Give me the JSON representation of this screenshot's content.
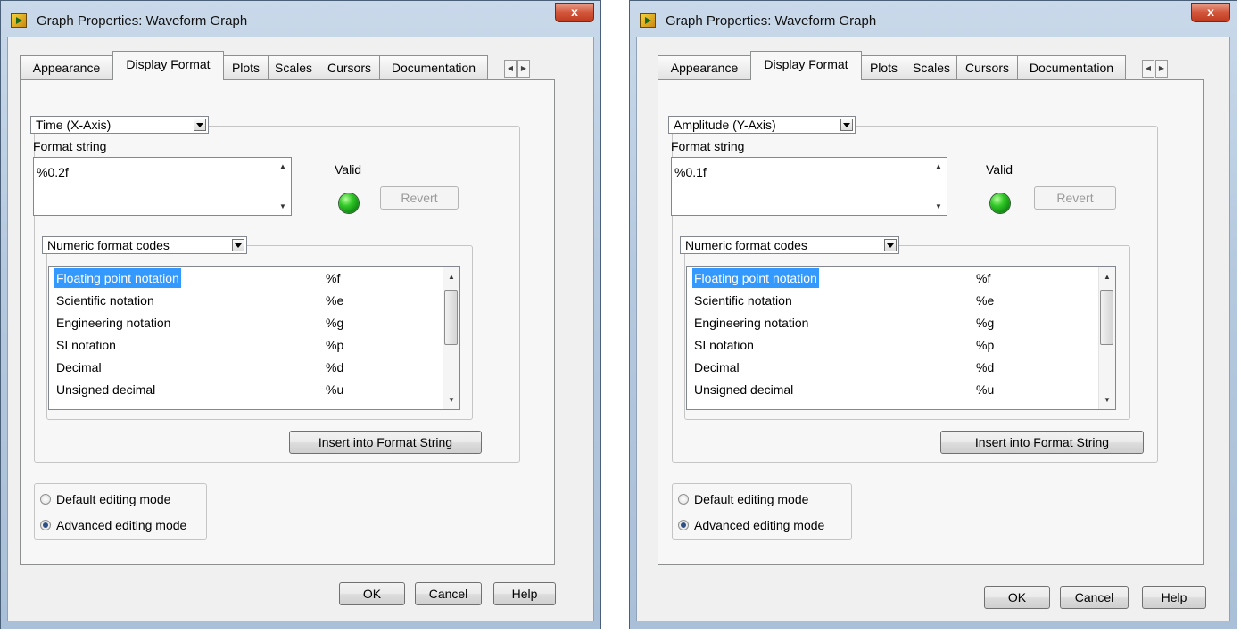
{
  "dialogs": [
    {
      "title": "Graph Properties: Waveform Graph",
      "close_label": "x",
      "tabs": [
        "Appearance",
        "Display Format",
        "Plots",
        "Scales",
        "Cursors",
        "Documentation"
      ],
      "active_tab": "Display Format",
      "axis_select": "Time (X-Axis)",
      "format_string_label": "Format string",
      "format_string_value": "%0.2f",
      "valid_label": "Valid",
      "revert_label": "Revert",
      "codes_select": "Numeric format codes",
      "codes": [
        {
          "name": "Floating point notation",
          "code": "%f"
        },
        {
          "name": "Scientific notation",
          "code": "%e"
        },
        {
          "name": "Engineering notation",
          "code": "%g"
        },
        {
          "name": "SI notation",
          "code": "%p"
        },
        {
          "name": "Decimal",
          "code": "%d"
        },
        {
          "name": "Unsigned decimal",
          "code": "%u"
        }
      ],
      "insert_label": "Insert into Format String",
      "modes": [
        "Default editing mode",
        "Advanced editing mode"
      ],
      "selected_mode": "Advanced editing mode",
      "ok_label": "OK",
      "cancel_label": "Cancel",
      "help_label": "Help"
    },
    {
      "title": "Graph Properties: Waveform Graph",
      "close_label": "x",
      "tabs": [
        "Appearance",
        "Display Format",
        "Plots",
        "Scales",
        "Cursors",
        "Documentation"
      ],
      "active_tab": "Display Format",
      "axis_select": "Amplitude (Y-Axis)",
      "format_string_label": "Format string",
      "format_string_value": "%0.1f",
      "valid_label": "Valid",
      "revert_label": "Revert",
      "codes_select": "Numeric format codes",
      "codes": [
        {
          "name": "Floating point notation",
          "code": "%f"
        },
        {
          "name": "Scientific notation",
          "code": "%e"
        },
        {
          "name": "Engineering notation",
          "code": "%g"
        },
        {
          "name": "SI notation",
          "code": "%p"
        },
        {
          "name": "Decimal",
          "code": "%d"
        },
        {
          "name": "Unsigned decimal",
          "code": "%u"
        }
      ],
      "insert_label": "Insert into Format String",
      "modes": [
        "Default editing mode",
        "Advanced editing mode"
      ],
      "selected_mode": "Advanced editing mode",
      "ok_label": "OK",
      "cancel_label": "Cancel",
      "help_label": "Help"
    }
  ]
}
